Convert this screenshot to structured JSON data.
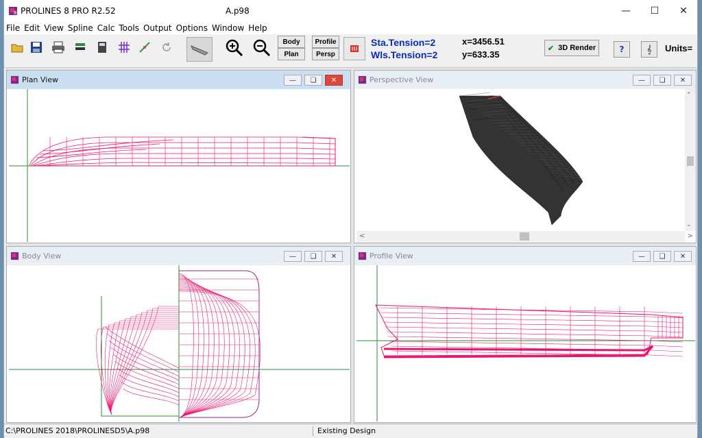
{
  "title_bar": {
    "app_title": "PROLINES 8 PRO R2.52",
    "doc_title": "A.p98"
  },
  "menu": [
    "File",
    "Edit",
    "View",
    "Spline",
    "Calc",
    "Tools",
    "Output",
    "Options",
    "Window",
    "Help"
  ],
  "toolbar": {
    "body_label": "Body",
    "plan_label": "Plan",
    "profile_label": "Profile",
    "persp_label": "Persp",
    "sta_tension": "Sta.Tension=2",
    "wls_tension": "Wls.Tension=2",
    "x": "x=3456.51",
    "y": "y=633.35",
    "render_label": "3D Render",
    "help_label": "?",
    "units_label": "Units="
  },
  "views": {
    "plan": "Plan View",
    "perspective": "Perspective View",
    "body": "Body View",
    "profile": "Profile View"
  },
  "status": {
    "path": "C:\\PROLINES 2018\\PROLINESD5\\A.p98",
    "state": "Existing Design"
  },
  "colors": {
    "hull_lines": "#e8156e",
    "grid_lines": "#2e8b3a",
    "caption_active": "#ccdff0"
  }
}
